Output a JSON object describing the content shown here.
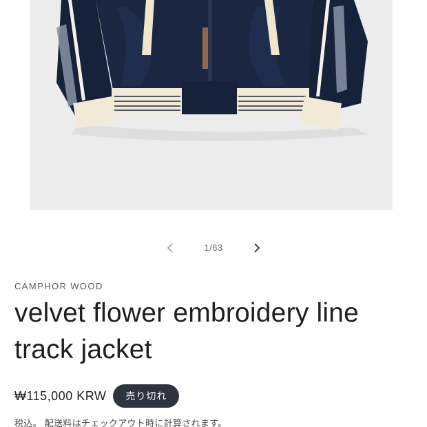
{
  "gallery": {
    "current_slide": "1/63",
    "prev_icon": "chevron-left-icon",
    "next_icon": "chevron-right-icon",
    "image_background": "#ececec"
  },
  "product": {
    "vendor": "CAMPHOR WOOD",
    "title": "velvet flower embroidery line track jacket",
    "price": "₩115,000 KRW",
    "sold_out_badge": "売り切れ",
    "tax_note": "税込。 配送料はチェックアウト時に計算されます。"
  },
  "colors": {
    "badge_bg": "#2e3340",
    "jacket_navy": "#16213a",
    "rib_cream": "#f1ead7"
  }
}
